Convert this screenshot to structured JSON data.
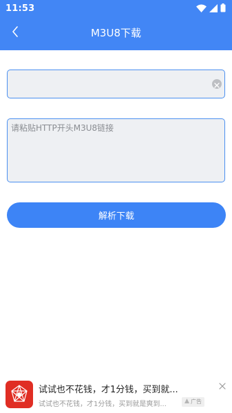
{
  "status_bar": {
    "time": "11:53",
    "icons": [
      "wifi-icon",
      "cellular-signal-icon",
      "battery-icon"
    ]
  },
  "toolbar": {
    "title": "M3U8下载",
    "back_icon": "chevron-left-icon"
  },
  "form": {
    "url_field": {
      "value": "",
      "clear_icon": "clear-icon"
    },
    "link_input": {
      "value": "",
      "placeholder": "请粘贴HTTP开头M3U8链接"
    },
    "parse_button_label": "解析下载"
  },
  "ad": {
    "title": "试试也不花钱，才1分钱，买到就...",
    "subtitle": "试试也不花钱，才1分钱，买到就是爽到...",
    "badge": "广告",
    "close_icon": "close-icon"
  },
  "colors": {
    "primary": "#4286f5",
    "button": "#3d84f6",
    "field_bg": "#eef0f3",
    "field_border": "#4a8ff0",
    "ad_logo": "#e02e24"
  }
}
